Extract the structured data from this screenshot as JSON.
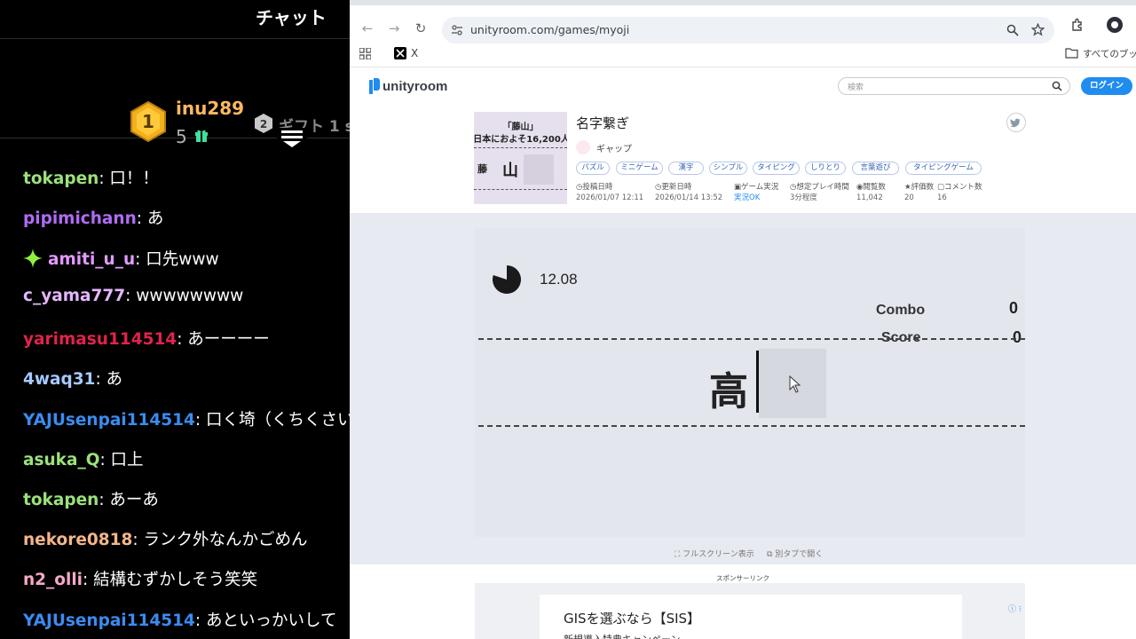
{
  "chat": {
    "title": "チャット",
    "top_gifter": {
      "rank": "1",
      "name": "inu289",
      "count": "5"
    },
    "second": {
      "rank": "2",
      "label": "ギフト 1 s"
    },
    "messages": [
      {
        "user": "tokapen",
        "color": "#9be27a",
        "text": ": 口！！"
      },
      {
        "user": "pipimichann",
        "color": "#b06cf4",
        "text": ": あ"
      },
      {
        "user": "amiti_u_u",
        "color": "#e39aff",
        "text": ": 口先www",
        "badge": "sparkle"
      },
      {
        "user": "c_yama777",
        "color": "#e3b7ff",
        "text": ": wwwwwwww"
      },
      {
        "user": "yarimasu114514",
        "color": "#e0234a",
        "text": ": あーーーー"
      },
      {
        "user": "4waq31",
        "color": "#a7c9ff",
        "text": ": あ"
      },
      {
        "user": "YAJUsenpai114514",
        "color": "#3a8cf0",
        "text": ": 口く埼（くちくさい"
      },
      {
        "user": "asuka_Q",
        "color": "#9be27a",
        "text": ": 口上"
      },
      {
        "user": "tokapen",
        "color": "#9be27a",
        "text": ": あーあ"
      },
      {
        "user": "nekore0818",
        "color": "#f3b68a",
        "text": ": ランク外なんかごめん"
      },
      {
        "user": "n2_olli",
        "color": "#f5a9c8",
        "text": ": 結構むずかしそう笑笑"
      },
      {
        "user": "YAJUsenpai114514",
        "color": "#3a8cf0",
        "text": ": あといっかいして"
      }
    ]
  },
  "browser": {
    "url": "unityroom.com/games/myoji",
    "bookmark_x": "X",
    "bookmark_all": "すべてのブックマ"
  },
  "site": {
    "logo": "unityroom",
    "search_placeholder": "検索",
    "login": "ログイン"
  },
  "game": {
    "thumb": {
      "line1": "「藤山」",
      "line2": "日本におよそ16,200人",
      "k1": "藤",
      "k2": "山"
    },
    "title": "名字繋ぎ",
    "author": "ギャップ",
    "tags": [
      "パズル",
      "ミニゲーム",
      "漢字",
      "シンプル",
      "タイピング",
      "しりとり",
      "言葉遊び",
      "タイピングゲーム"
    ],
    "stats": [
      {
        "label": "投稿日時",
        "value": "2026/01/07 12:11"
      },
      {
        "label": "更新日時",
        "value": "2026/01/14 13:52"
      },
      {
        "label": "ゲーム実況",
        "value": "実況OK"
      },
      {
        "label": "想定プレイ時間",
        "value": "3分程度"
      },
      {
        "label": "閲覧数",
        "value": "11,042"
      },
      {
        "label": "評価数",
        "value": "20"
      },
      {
        "label": "コメント数",
        "value": "16"
      }
    ]
  },
  "play": {
    "timer": "12.08",
    "timer_fraction_remaining": 0.8,
    "combo_label": "Combo",
    "combo": "0",
    "score_label": "Score",
    "score": "0",
    "kanji": "高"
  },
  "below": {
    "fullscreen": "フルスクリーン表示",
    "newtab": "別タブで開く"
  },
  "ad": {
    "sponsor": "スポンサーリンク",
    "title": "GISを選ぶなら【SIS】",
    "subtitle": "新規導入特典キャンペーン"
  }
}
